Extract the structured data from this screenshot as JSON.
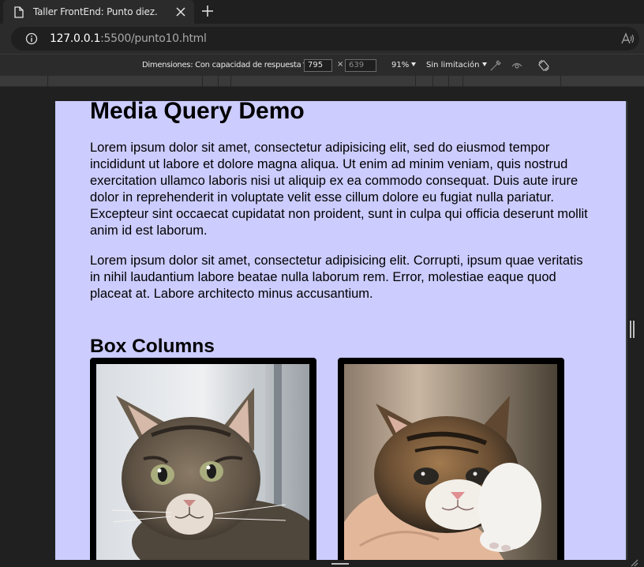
{
  "browser": {
    "tab_title": "Taller FrontEnd: Punto diez.",
    "url_host": "127.0.0.1",
    "url_rest": ":5500/punto10.html"
  },
  "devtools": {
    "dimensions_label": "Dimensiones: Con capacidad de respuesta",
    "width": "795",
    "height_placeholder": "639",
    "times": "×",
    "zoom": "91%",
    "throttle": "Sin limitación"
  },
  "page": {
    "title": "Media Query Demo",
    "paragraph1": "Lorem ipsum dolor sit amet, consectetur adipisicing elit, sed do eiusmod tempor incididunt ut labore et dolore magna aliqua. Ut enim ad minim veniam, quis nostrud exercitation ullamco laboris nisi ut aliquip ex ea commodo consequat. Duis aute irure dolor in reprehenderit in voluptate velit esse cillum dolore eu fugiat nulla pariatur. Excepteur sint occaecat cupidatat non proident, sunt in culpa qui officia deserunt mollit anim id est laborum.",
    "paragraph2": "Lorem ipsum dolor sit amet, consectetur adipisicing elit. Corrupti, ipsum quae veritatis in nihil laudantium labore beatae nulla laborum rem. Error, molestiae eaque quod placeat at. Labore architecto minus accusantium.",
    "section_title": "Box Columns",
    "images": [
      {
        "subject": "kitten sitting by window"
      },
      {
        "subject": "kitten held in hand"
      }
    ]
  },
  "colors": {
    "page_background": "#ccccff",
    "chrome_dark": "#1f1f1f",
    "chrome_mid": "#2b2b2b"
  }
}
